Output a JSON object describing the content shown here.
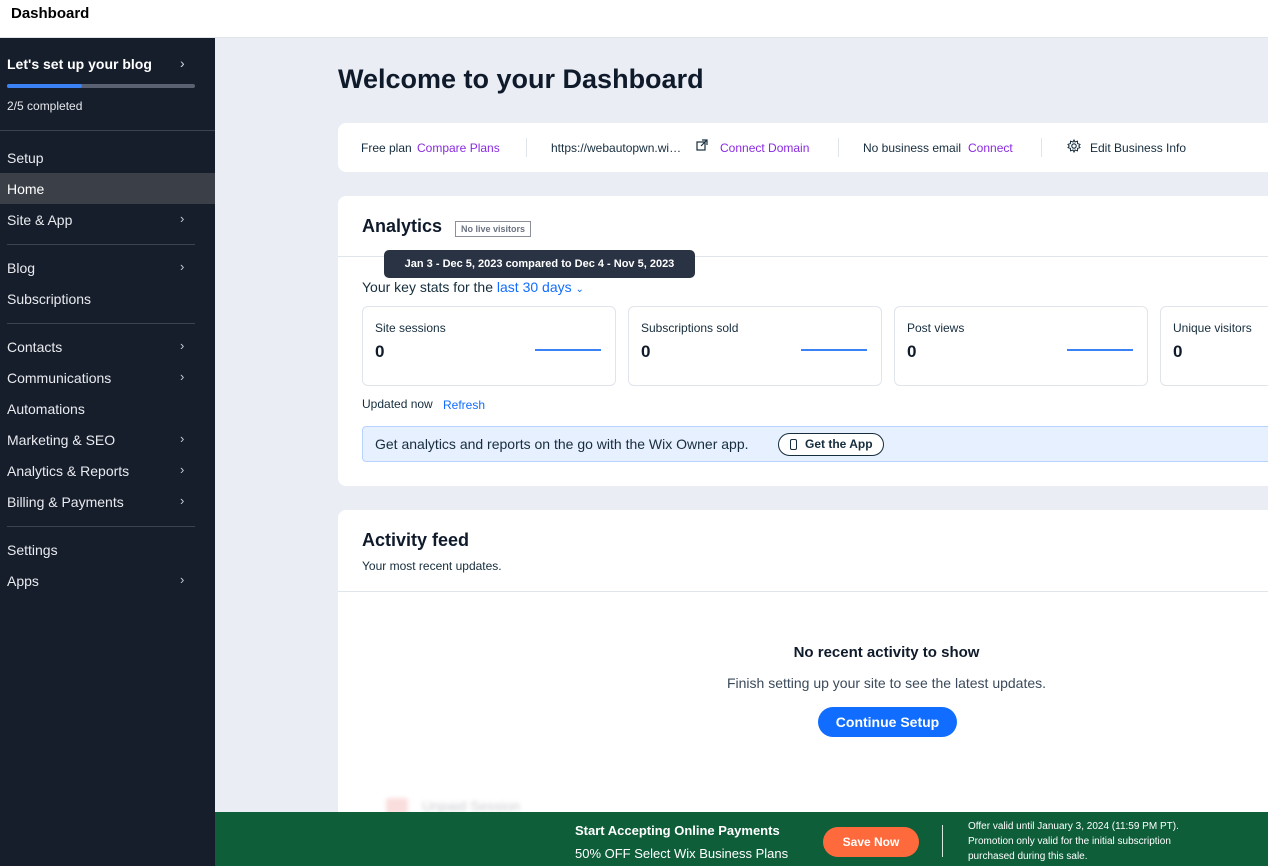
{
  "topbar": {
    "title": "Dashboard"
  },
  "sidebar": {
    "setup": {
      "title": "Let's set up your blog",
      "progress_text": "2/5 completed",
      "progress_fraction": 0.4
    },
    "items": [
      {
        "label": "Setup"
      },
      {
        "label": "Home"
      },
      {
        "label": "Site & App"
      },
      {
        "label": "Blog"
      },
      {
        "label": "Subscriptions"
      },
      {
        "label": "Contacts"
      },
      {
        "label": "Communications"
      },
      {
        "label": "Automations"
      },
      {
        "label": "Marketing & SEO"
      },
      {
        "label": "Analytics & Reports"
      },
      {
        "label": "Billing & Payments"
      },
      {
        "label": "Settings"
      },
      {
        "label": "Apps"
      }
    ]
  },
  "main": {
    "welcome": "Welcome to your Dashboard",
    "infobar": {
      "plan": "Free plan",
      "compare_plans": "Compare Plans",
      "site_url": "https://webautopwn.wi…",
      "connect_domain": "Connect Domain",
      "no_email": "No business email",
      "connect": "Connect",
      "edit_business": "Edit Business Info"
    },
    "analytics": {
      "title": "Analytics",
      "badge": "No live visitors",
      "tooltip": "Jan 3 - Dec 5, 2023 compared to Dec 4 - Nov 5, 2023",
      "key_stats_prefix": "Your key stats for the",
      "period": "last 30 days",
      "stats": [
        {
          "label": "Site sessions",
          "value": "0"
        },
        {
          "label": "Subscriptions sold",
          "value": "0"
        },
        {
          "label": "Post views",
          "value": "0"
        },
        {
          "label": "Unique visitors",
          "value": "0"
        }
      ],
      "updated": "Updated now",
      "refresh": "Refresh",
      "app_promo": "Get analytics and reports on the go with the Wix Owner app.",
      "get_app": "Get the App"
    },
    "activity": {
      "title": "Activity feed",
      "subtitle": "Your most recent updates.",
      "empty_title": "No recent activity to show",
      "empty_sub": "Finish setting up your site to see the latest updates.",
      "continue": "Continue Setup",
      "ghost_item": "Unpaid Session"
    }
  },
  "banner": {
    "title": "Start Accepting Online Payments",
    "subtitle": "50% OFF Select Wix Business Plans",
    "save": "Save Now",
    "offer": "Offer valid until January 3, 2024 (11:59 PM PT). Promotion only valid for the initial subscription purchased during this sale."
  },
  "colors": {
    "sidebar_bg": "#161d2b",
    "accent_blue": "#116dff",
    "link_purple": "#8a2be2",
    "banner_green": "#0e5e3a",
    "save_orange": "#ff6a3d"
  },
  "icons": [
    "chevron-right-icon",
    "external-link-icon",
    "gear-icon",
    "chevron-down-icon",
    "phone-icon"
  ]
}
